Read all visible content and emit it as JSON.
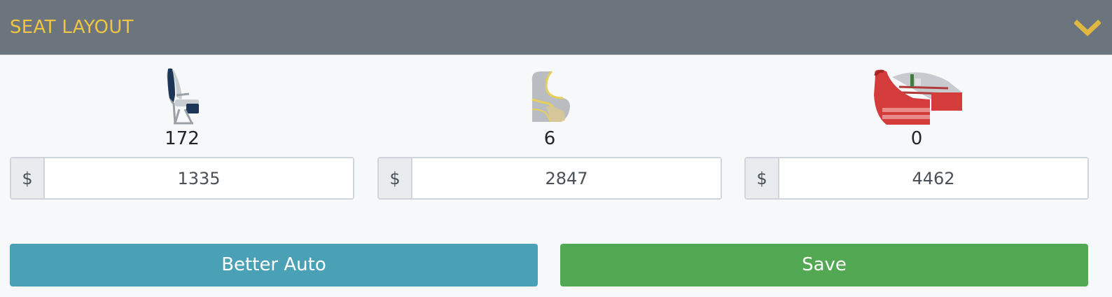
{
  "header": {
    "title": "SEAT LAYOUT",
    "chevron_icon": "chevron-down-icon",
    "title_color": "#f0c542"
  },
  "classes": [
    {
      "icon": "economy-seat-icon",
      "count": "172",
      "currency": "$",
      "price": "1335"
    },
    {
      "icon": "business-seat-icon",
      "count": "6",
      "currency": "$",
      "price": "2847"
    },
    {
      "icon": "first-class-seat-icon",
      "count": "0",
      "currency": "$",
      "price": "4462"
    }
  ],
  "actions": {
    "better_auto_label": "Better Auto",
    "save_label": "Save",
    "better_auto_color": "#4aa1b6",
    "save_color": "#52a853"
  }
}
